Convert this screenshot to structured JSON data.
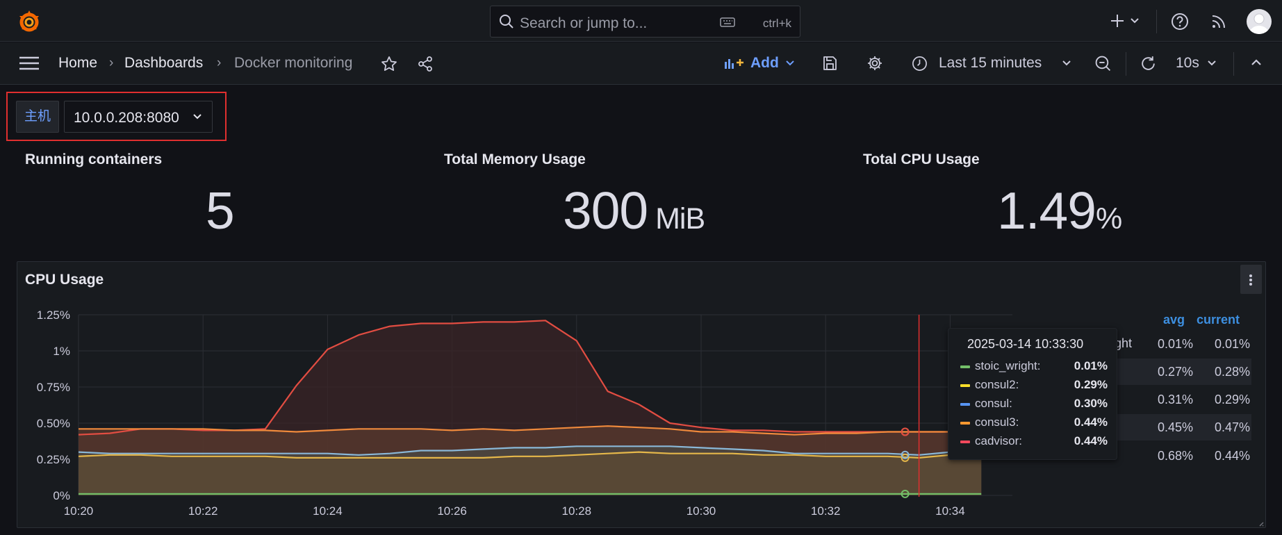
{
  "topbar": {
    "search_placeholder": "Search or jump to...",
    "search_shortcut": "ctrl+k",
    "icons": [
      "grafana-logo",
      "search-icon",
      "keyboard-icon",
      "plus-icon",
      "chevron-down-icon",
      "help-icon",
      "rss-icon",
      "avatar"
    ]
  },
  "nav": {
    "breadcrumbs": [
      "Home",
      "Dashboards",
      "Docker monitoring"
    ],
    "add_label": "Add",
    "time_range": "Last 15 minutes",
    "refresh_interval": "10s"
  },
  "variables": {
    "host_label": "主机",
    "host_value": "10.0.0.208:8080"
  },
  "stats": [
    {
      "title": "Running containers",
      "value": "5",
      "unit": ""
    },
    {
      "title": "Total Memory Usage",
      "value": "300",
      "unit": " MiB"
    },
    {
      "title": "Total CPU Usage",
      "value": "1.49",
      "unit": "%"
    }
  ],
  "cpu_panel": {
    "title": "CPU Usage",
    "legend_headers": {
      "avg": "avg",
      "current": "current"
    },
    "legend_rows": [
      {
        "name": "stoic_wright",
        "avg": "0.01%",
        "current": "0.01%"
      },
      {
        "name": "consul2",
        "avg": "0.27%",
        "current": "0.28%"
      },
      {
        "name": "consul",
        "avg": "0.31%",
        "current": "0.29%"
      },
      {
        "name": "consul3",
        "avg": "0.45%",
        "current": "0.47%"
      },
      {
        "name": "cadvisor",
        "avg": "0.68%",
        "current": "0.44%"
      }
    ],
    "legend_visible_name_fragment": "ght",
    "tooltip": {
      "time": "2025-03-14 10:33:30",
      "rows": [
        {
          "name": "stoic_wright:",
          "value": "0.01%",
          "color": "#73bf69"
        },
        {
          "name": "consul2:",
          "value": "0.29%",
          "color": "#fade2a"
        },
        {
          "name": "consul:",
          "value": "0.30%",
          "color": "#5794f2"
        },
        {
          "name": "consul3:",
          "value": "0.44%",
          "color": "#ff9830"
        },
        {
          "name": "cadvisor:",
          "value": "0.44%",
          "color": "#f2495c"
        }
      ]
    }
  },
  "chart_data": {
    "type": "area",
    "title": "CPU Usage",
    "x_ticks": [
      "10:20",
      "10:22",
      "10:24",
      "10:26",
      "10:28",
      "10:30",
      "10:32",
      "10:34"
    ],
    "y_ticks": [
      "0%",
      "0.25%",
      "0.50%",
      "0.75%",
      "1%",
      "1.25%"
    ],
    "ylim": [
      0,
      1.25
    ],
    "x_minutes": [
      0,
      0.5,
      1,
      1.5,
      2,
      2.5,
      3,
      3.5,
      4,
      4.5,
      5,
      5.5,
      6,
      6.5,
      7,
      7.5,
      8,
      8.5,
      9,
      9.5,
      10,
      10.5,
      11,
      11.5,
      12,
      12.5,
      13,
      13.5,
      14,
      14.5
    ],
    "xlim_minutes": [
      0,
      14.5
    ],
    "cursor_minute": 13.5,
    "series": [
      {
        "name": "stoic_wright",
        "color": "#73bf69",
        "fill": "#3d3d28",
        "values": [
          0.01,
          0.01,
          0.01,
          0.01,
          0.01,
          0.01,
          0.01,
          0.01,
          0.01,
          0.01,
          0.01,
          0.01,
          0.01,
          0.01,
          0.01,
          0.01,
          0.01,
          0.01,
          0.01,
          0.01,
          0.01,
          0.01,
          0.01,
          0.01,
          0.01,
          0.01,
          0.01,
          0.01,
          0.01,
          0.01
        ]
      },
      {
        "name": "consul2",
        "color": "#e6b84a",
        "fill": "#5c4a33",
        "values": [
          0.27,
          0.28,
          0.28,
          0.27,
          0.27,
          0.27,
          0.27,
          0.26,
          0.26,
          0.26,
          0.26,
          0.26,
          0.26,
          0.26,
          0.27,
          0.27,
          0.28,
          0.29,
          0.3,
          0.29,
          0.29,
          0.29,
          0.28,
          0.28,
          0.27,
          0.27,
          0.27,
          0.26,
          0.28,
          0.28
        ]
      },
      {
        "name": "consul",
        "color": "#8ab8d8",
        "fill": "#4a4a44",
        "values": [
          0.3,
          0.29,
          0.29,
          0.29,
          0.29,
          0.29,
          0.29,
          0.29,
          0.29,
          0.28,
          0.29,
          0.31,
          0.31,
          0.32,
          0.33,
          0.33,
          0.34,
          0.34,
          0.34,
          0.34,
          0.33,
          0.32,
          0.31,
          0.29,
          0.29,
          0.29,
          0.29,
          0.28,
          0.3,
          0.29
        ]
      },
      {
        "name": "consul3",
        "color": "#f08a3c",
        "fill": "#5a3a2e",
        "values": [
          0.46,
          0.46,
          0.46,
          0.46,
          0.46,
          0.45,
          0.45,
          0.44,
          0.45,
          0.46,
          0.46,
          0.46,
          0.45,
          0.46,
          0.45,
          0.46,
          0.47,
          0.48,
          0.47,
          0.46,
          0.44,
          0.44,
          0.43,
          0.42,
          0.43,
          0.43,
          0.44,
          0.44,
          0.44,
          0.47
        ]
      },
      {
        "name": "cadvisor",
        "color": "#e24d42",
        "fill": "#3a2427",
        "values": [
          0.42,
          0.43,
          0.46,
          0.46,
          0.45,
          0.45,
          0.46,
          0.76,
          1.01,
          1.11,
          1.17,
          1.19,
          1.19,
          1.2,
          1.2,
          1.21,
          1.07,
          0.72,
          0.63,
          0.5,
          0.47,
          0.45,
          0.45,
          0.44,
          0.44,
          0.44,
          0.44,
          0.44,
          0.44,
          0.44
        ]
      }
    ]
  }
}
